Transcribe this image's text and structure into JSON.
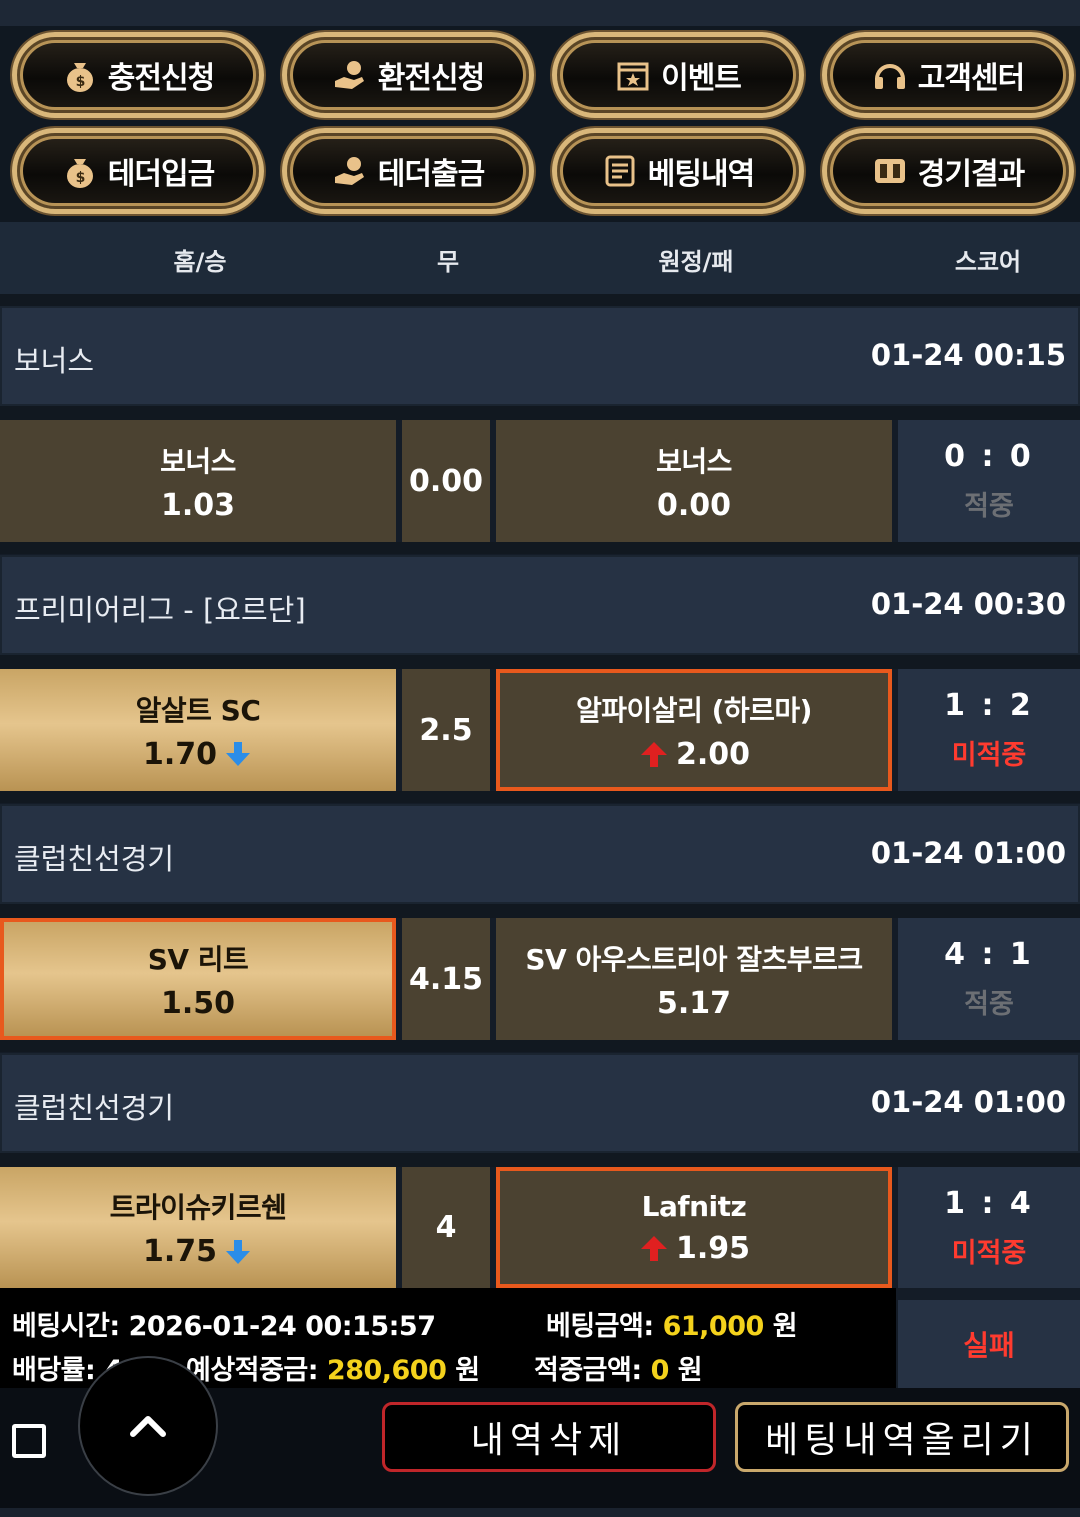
{
  "menu": {
    "items": [
      {
        "label": "충전신청",
        "icon": "money-bag-icon"
      },
      {
        "label": "환전신청",
        "icon": "hand-coin-icon"
      },
      {
        "label": "이벤트",
        "icon": "calendar-star-icon"
      },
      {
        "label": "고객센터",
        "icon": "headset-icon"
      },
      {
        "label": "테더입금",
        "icon": "money-bag-icon"
      },
      {
        "label": "테더출금",
        "icon": "hand-coin-icon"
      },
      {
        "label": "베팅내역",
        "icon": "list-document-icon"
      },
      {
        "label": "경기결과",
        "icon": "scoreboard-icon"
      }
    ]
  },
  "columns": {
    "home": "홈/승",
    "draw": "무",
    "away": "원정/패",
    "score": "스코어"
  },
  "matches": [
    {
      "league": "보너스",
      "time": "01-24 00:15",
      "home": {
        "name": "보너스",
        "odds": "1.03"
      },
      "mid": "0.00",
      "away": {
        "name": "보너스",
        "odds": "0.00"
      },
      "score": "0 : 0",
      "result": "적중"
    },
    {
      "league": "프리미어리그 - [요르단]",
      "time": "01-24 00:30",
      "home": {
        "name": "알살트 SC",
        "odds": "1.70",
        "trend": "down"
      },
      "mid": "2.5",
      "away": {
        "name": "알파이살리 (하르마)",
        "odds": "2.00",
        "trend": "up"
      },
      "score": "1 : 2",
      "result": "미적중"
    },
    {
      "league": "클럽친선경기",
      "time": "01-24 01:00",
      "home": {
        "name": "SV 리트",
        "odds": "1.50"
      },
      "mid": "4.15",
      "away": {
        "name": "SV 아우스트리아 잘츠부르크",
        "odds": "5.17"
      },
      "score": "4 : 1",
      "result": "적중"
    },
    {
      "league": "클럽친선경기",
      "time": "01-24 01:00",
      "home": {
        "name": "트라이슈키르쉔",
        "odds": "1.75",
        "trend": "down"
      },
      "mid": "4",
      "away": {
        "name": "Lafnitz",
        "odds": "1.95",
        "trend": "up"
      },
      "score": "1 : 4",
      "result": "미적중"
    }
  ],
  "summary": {
    "bet_time_label": "베팅시간:",
    "bet_time": "2026-01-24 00:15:57",
    "bet_amount_label": "베팅금액:",
    "bet_amount": "61,000",
    "won": "원",
    "odds_label": "배당률:",
    "odds_partial": "4.0",
    "expected_label": "예상적중금:",
    "expected": "280,600",
    "won_amount_label": "적중금액:",
    "won_amount": "0",
    "status": "실패"
  },
  "actions": {
    "delete": "내역삭제",
    "upload": "베팅내역올리기"
  },
  "colors": {
    "gold": "#d9b77a",
    "selected": "#e8591d",
    "miss": "#ff3b2f",
    "highlight": "#f4d21c",
    "up_arrow": "#e02020",
    "down_arrow": "#2b8de8"
  }
}
